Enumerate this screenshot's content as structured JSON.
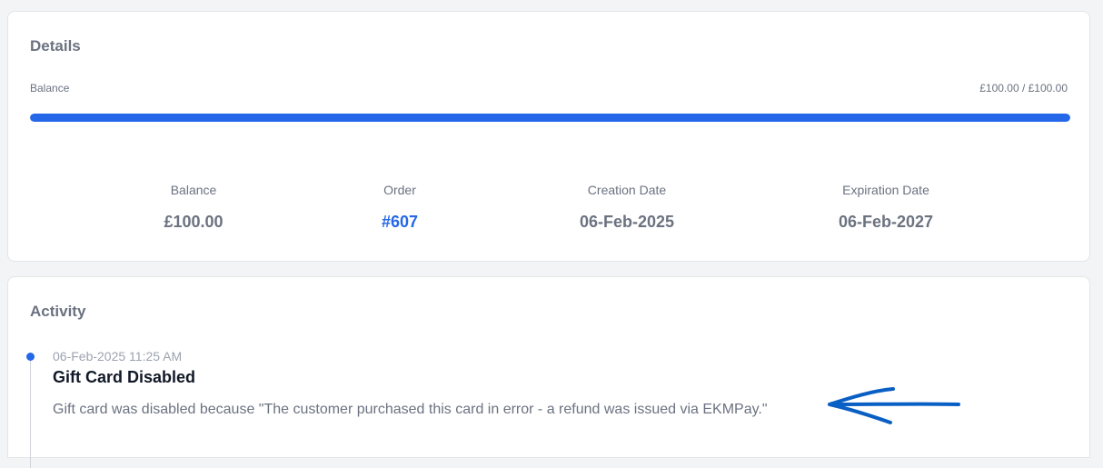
{
  "details": {
    "title": "Details",
    "balance_label": "Balance",
    "balance_amount": "£100.00 / £100.00",
    "balance_fraction": 1.0,
    "stats": {
      "balance": {
        "label": "Balance",
        "value": "£100.00"
      },
      "order": {
        "label": "Order",
        "value": "#607"
      },
      "creation_date": {
        "label": "Creation Date",
        "value": "06-Feb-2025"
      },
      "expiration_date": {
        "label": "Expiration Date",
        "value": "06-Feb-2027"
      }
    }
  },
  "activity": {
    "title": "Activity",
    "items": [
      {
        "timestamp": "06-Feb-2025 11:25 AM",
        "title": "Gift Card Disabled",
        "description": "Gift card was disabled because \"The customer purchased this card in error - a refund was issued via EKMPay.\""
      }
    ]
  },
  "colors": {
    "accent": "#2467e8",
    "annotation": "#0a5fc4"
  }
}
